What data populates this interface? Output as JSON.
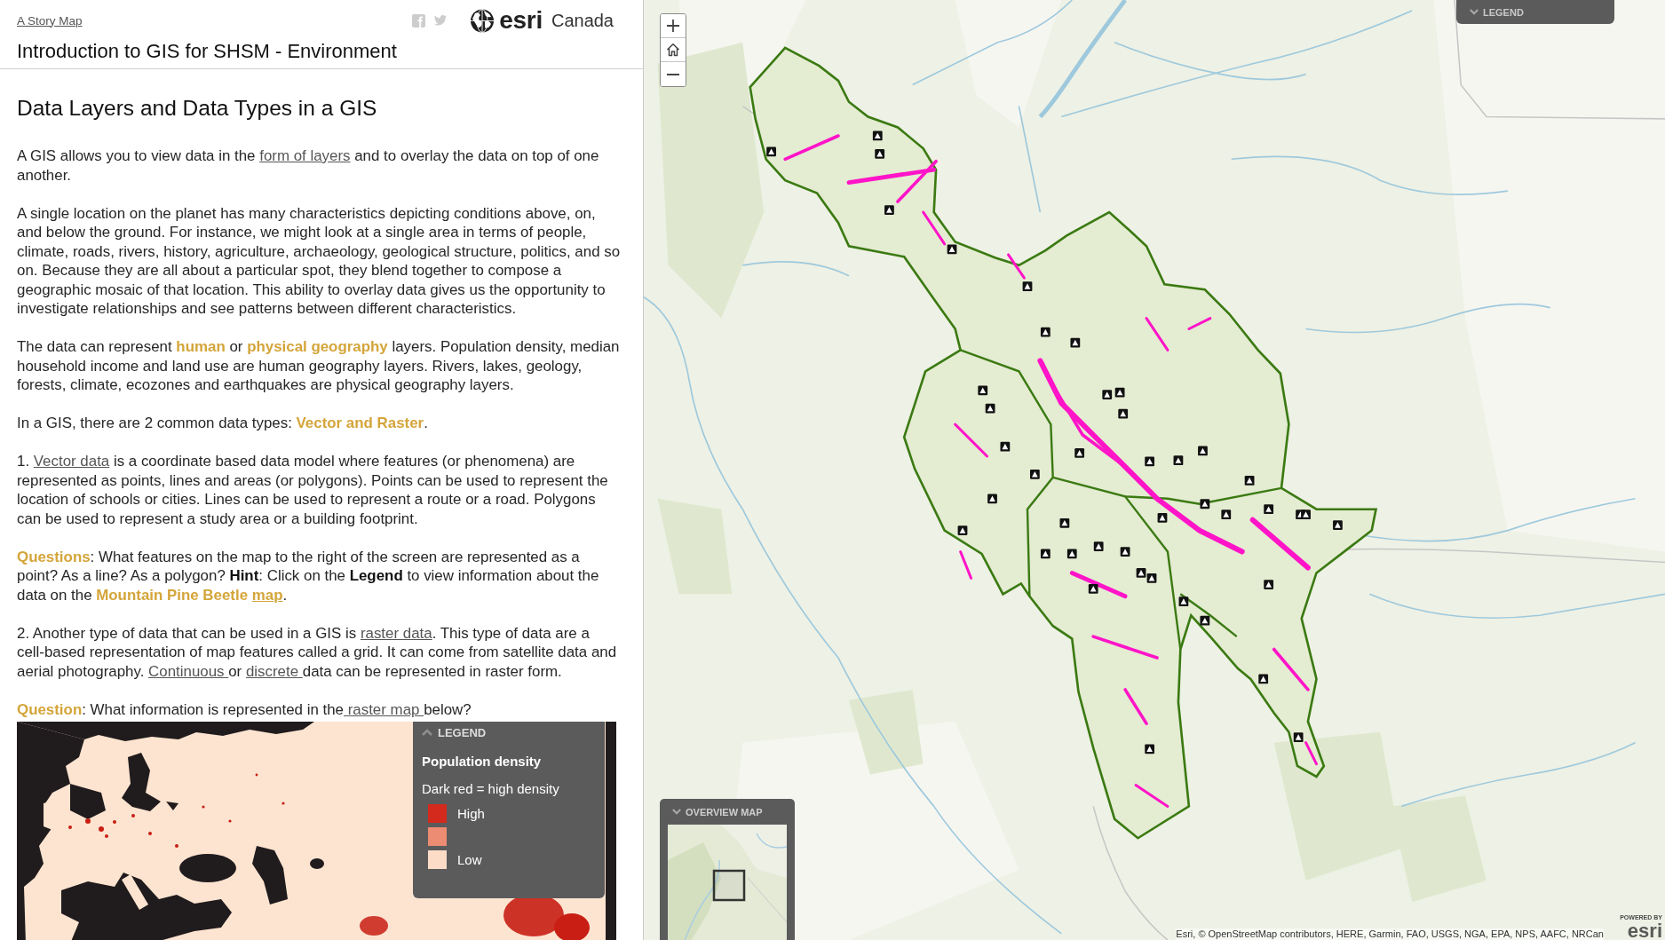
{
  "header": {
    "story_link": "A Story Map",
    "title": "Introduction to GIS for SHSM - Environment",
    "logo": {
      "wordmark": "esri",
      "region": "Canada"
    }
  },
  "section": {
    "heading": "Data Layers and Data Types in a GIS",
    "paragraphs": [
      {
        "runs": [
          {
            "kind": "text",
            "text": "A GIS allows you to view data in the "
          },
          {
            "kind": "link",
            "text": "form of layers"
          },
          {
            "kind": "text",
            "text": " and to overlay the data on top of one another."
          }
        ]
      },
      {
        "runs": [
          {
            "kind": "text",
            "text": "A single location on the planet has many characteristics depicting conditions above, on, and below the ground. For instance, we might look at a single area in terms of people, climate, roads, rivers, history, agriculture, archaeology, geological structure, politics, and so on. Because they are all about a particular spot, they blend together to compose a geographic mosaic of that location. This ability to overlay data gives us the opportunity to investigate relationships and see patterns between different characteristics."
          }
        ]
      },
      {
        "runs": [
          {
            "kind": "text",
            "text": "The data can represent "
          },
          {
            "kind": "highlight",
            "text": "human"
          },
          {
            "kind": "text",
            "text": " or "
          },
          {
            "kind": "highlight",
            "text": "physical geography"
          },
          {
            "kind": "text",
            "text": " layers. Population density, median household income and land use are human geography layers. Rivers, lakes, geology, forests, climate, ecozones and earthquakes are physical geography layers."
          }
        ]
      },
      {
        "runs": [
          {
            "kind": "text",
            "text": "In a GIS, there are 2 common data types: "
          },
          {
            "kind": "highlight",
            "text": "Vector and Raster"
          },
          {
            "kind": "text",
            "text": "."
          }
        ]
      },
      {
        "runs": [
          {
            "kind": "text",
            "text": "1. "
          },
          {
            "kind": "link",
            "text": "Vector data"
          },
          {
            "kind": "text",
            "text": " is a coordinate based data model where features (or phenomena) are represented as points, lines and areas (or polygons). Points can be used to represent the location of schools or cities. Lines can be used to represent a route or a road. Polygons can be used to represent a study area or a building footprint."
          }
        ]
      },
      {
        "runs": [
          {
            "kind": "highlight",
            "text": "Questions"
          },
          {
            "kind": "text",
            "text": ": What features on the map to the right of the screen are represented as a point? As a line? As a polygon? "
          },
          {
            "kind": "bold",
            "text": "Hint"
          },
          {
            "kind": "text",
            "text": ": Click on the "
          },
          {
            "kind": "bold",
            "text": "Legend"
          },
          {
            "kind": "text",
            "text": " to view information about the data on the "
          },
          {
            "kind": "highlight",
            "text": "Mountain Pine Beetle "
          },
          {
            "kind": "highlight-link",
            "text": "map"
          },
          {
            "kind": "text",
            "text": "."
          }
        ]
      },
      {
        "runs": [
          {
            "kind": "text",
            "text": "2. Another type of data that can be used in a GIS is "
          },
          {
            "kind": "link",
            "text": "raster data"
          },
          {
            "kind": "text",
            "text": ". This type of data are a cell-based representation of map features called a grid. It can come from satellite data and aerial photography. "
          },
          {
            "kind": "link",
            "text": "Continuous "
          },
          {
            "kind": "text",
            "text": "or "
          },
          {
            "kind": "link",
            "text": "discrete "
          },
          {
            "kind": "text",
            "text": "data can be represented in raster form."
          }
        ]
      },
      {
        "runs": [
          {
            "kind": "highlight",
            "text": "Question"
          },
          {
            "kind": "text",
            "text": ": What information is represented in the"
          },
          {
            "kind": "link",
            "text": " raster map "
          },
          {
            "kind": "text",
            "text": "below?"
          }
        ]
      }
    ],
    "raster_map": {
      "legend": {
        "title": "LEGEND",
        "expanded": true,
        "layer": "Population density",
        "note": "Dark red = high density",
        "items": [
          {
            "label": "High",
            "color": "#d42a1e"
          },
          {
            "color": "#ec8c72"
          },
          {
            "label": "Low",
            "color": "#fcdcc6"
          }
        ]
      }
    }
  },
  "map": {
    "legend": {
      "title": "LEGEND",
      "expanded": false
    },
    "overview": {
      "title": "OVERVIEW MAP",
      "expanded": true
    },
    "attribution": "Esri, © OpenStreetMap contributors, HERE, Garmin, FAO, USGS, NGA, EPA, NPS, AAFC, NRCan",
    "powered_by": {
      "caption": "POWERED BY",
      "wordmark": "esri"
    }
  }
}
